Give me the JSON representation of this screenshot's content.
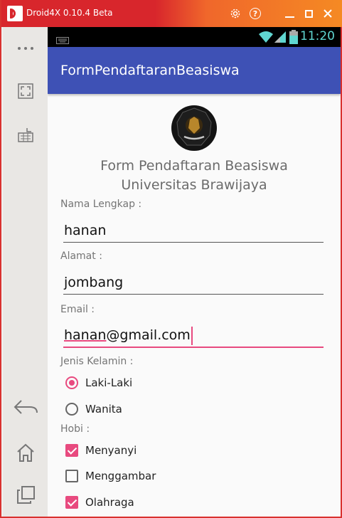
{
  "window": {
    "title": "Droid4X 0.10.4 Beta",
    "accent_color": "#d8262c"
  },
  "sidebar": {
    "items": [
      {
        "icon": "more-dots-icon"
      },
      {
        "icon": "fullscreen-icon"
      },
      {
        "icon": "keyboard-icon"
      },
      {
        "icon": "back-icon"
      },
      {
        "icon": "home-icon"
      },
      {
        "icon": "recent-apps-icon"
      }
    ]
  },
  "status_bar": {
    "time": "11:20",
    "icons": [
      "wifi-icon",
      "signal-icon",
      "battery-icon"
    ]
  },
  "app": {
    "title": "FormPendaftaranBeasiswa",
    "primary_color": "#3e51b5",
    "accent_color": "#e84a7f"
  },
  "form": {
    "heading_line1": "Form Pendaftaran Beasiswa",
    "heading_line2": "Universitas Brawijaya",
    "name": {
      "label": "Nama Lengkap :",
      "value": "hanan"
    },
    "address": {
      "label": "Alamat :",
      "value": "jombang"
    },
    "email": {
      "label": "Email :",
      "value_part1": "hanan",
      "value_part2": "@gmail.com"
    },
    "gender": {
      "label": "Jenis Kelamin :",
      "options": [
        {
          "label": "Laki-Laki",
          "selected": true
        },
        {
          "label": "Wanita",
          "selected": false
        }
      ]
    },
    "hobby": {
      "label": "Hobi :",
      "options": [
        {
          "label": "Menyanyi",
          "checked": true
        },
        {
          "label": "Menggambar",
          "checked": false
        },
        {
          "label": "Olahraga",
          "checked": true
        }
      ]
    }
  }
}
